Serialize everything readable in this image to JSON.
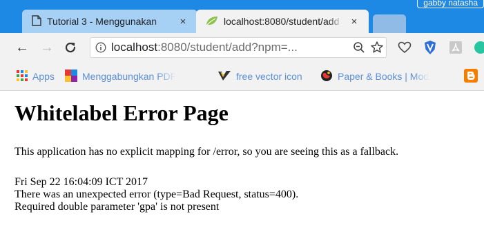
{
  "window": {
    "profile_name": "gabby natasha"
  },
  "tabs": [
    {
      "title": "Tutorial 3 - Menggunakan",
      "close": "×",
      "icon": "document-icon"
    },
    {
      "title": "localhost:8080/student/add",
      "close": "×",
      "icon": "spring-leaf-icon"
    }
  ],
  "toolbar": {
    "back": "←",
    "forward": "→",
    "reload": "C",
    "url_host": "localhost",
    "url_path": ":8080/student/add?npm=...",
    "icons": [
      "info-icon",
      "zoom-icon",
      "star-icon",
      "heart-icon",
      "shield-icon",
      "pdf-icon",
      "avatar-icon"
    ]
  },
  "bookmarks": [
    {
      "label": "Apps",
      "icon": "apps-grid-icon"
    },
    {
      "label": "Menggabungkan PDF",
      "icon": "colorful-squares-icon"
    },
    {
      "label": "free vector icon",
      "icon": "vector-check-icon"
    },
    {
      "label": "Paper & Books | Mod",
      "icon": "globe-icon"
    },
    {
      "label": "",
      "icon": "blogger-icon"
    }
  ],
  "page": {
    "heading": "Whitelabel Error Page",
    "description": "This application has no explicit mapping for /error, so you are seeing this as a fallback.",
    "timestamp": "Fri Sep 22 16:04:09 ICT 2017",
    "error_message": "There was an unexpected error (type=Bad Request, status=400).",
    "detail_message": "Required double parameter 'gpa' is not present"
  },
  "colors": {
    "titlebar": "#1e88e5",
    "toolbar": "#f2f2f2",
    "bookmark_text": "#5a8fd6"
  }
}
